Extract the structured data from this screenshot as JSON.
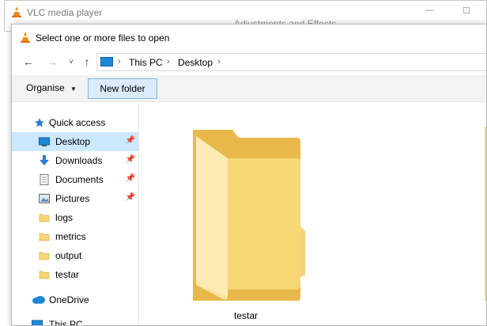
{
  "vlc_window": {
    "title": "VLC media player",
    "behind_text": "Adjustments and Effects"
  },
  "dialog": {
    "title": "Select one or more files to open",
    "address": {
      "crumbs": [
        "This PC",
        "Desktop"
      ]
    },
    "toolbar": {
      "organise_label": "Organise",
      "new_folder_label": "New folder"
    },
    "nav": {
      "quick_access": "Quick access",
      "items": [
        {
          "label": "Desktop",
          "pinned": true,
          "selected": true
        },
        {
          "label": "Downloads",
          "pinned": true
        },
        {
          "label": "Documents",
          "pinned": true
        },
        {
          "label": "Pictures",
          "pinned": true
        },
        {
          "label": "logs"
        },
        {
          "label": "metrics"
        },
        {
          "label": "output"
        },
        {
          "label": "testar"
        }
      ],
      "onedrive": "OneDrive",
      "this_pc": "This PC"
    },
    "content": {
      "folder_name": "testar"
    }
  },
  "colors": {
    "selection": "#cce8ff",
    "accent": "#1e88d6",
    "folder": "#f8d775"
  }
}
